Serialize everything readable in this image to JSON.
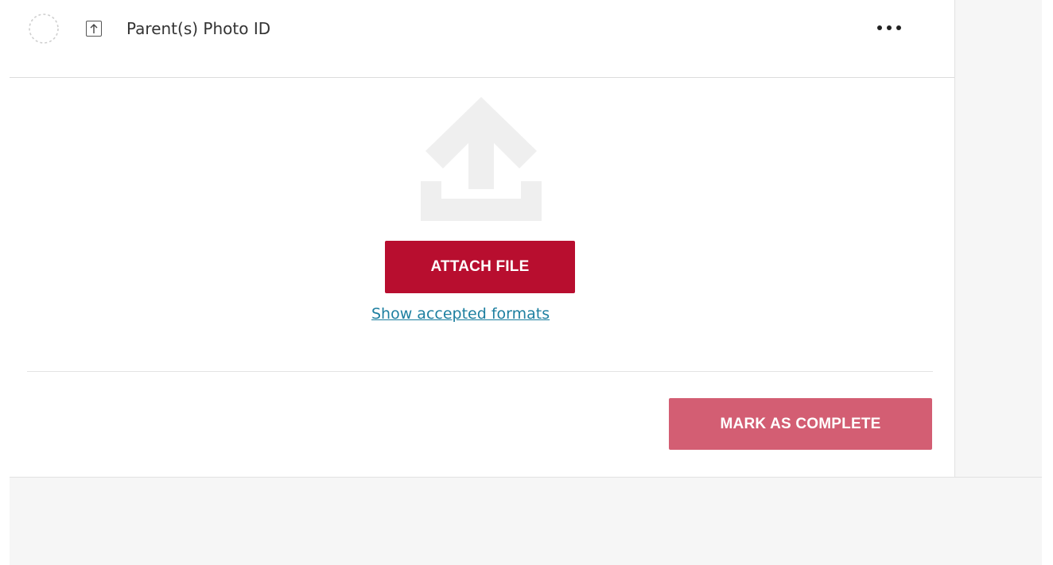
{
  "task": {
    "title": "Parent(s) Photo ID",
    "status_icon": "dashed-circle-icon",
    "type_icon": "upload-icon",
    "menu_icon": "more-horizontal-icon"
  },
  "upload": {
    "illustration_icon": "upload-tray-icon",
    "attach_label": "ATTACH FILE",
    "formats_link": "Show accepted formats"
  },
  "footer": {
    "complete_label": "MARK AS COMPLETE"
  },
  "colors": {
    "primary": "#b80e2f",
    "primary_disabled": "#d35e73",
    "link": "#1d7fa0",
    "illustration": "#eeeeee",
    "gutter": "#f6f6f6"
  }
}
